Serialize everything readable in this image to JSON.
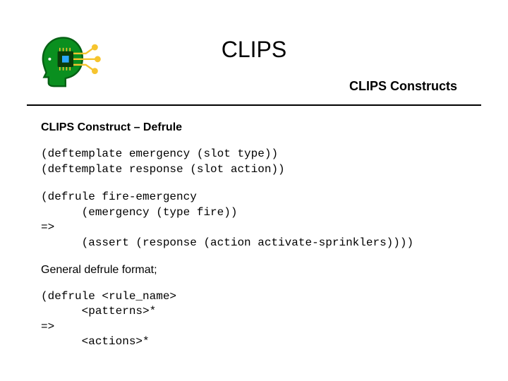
{
  "header": {
    "title": "CLIPS",
    "subtitle": "CLIPS Constructs"
  },
  "body": {
    "section_heading": "CLIPS Construct – Defrule",
    "code1": "(deftemplate emergency (slot type))\n(deftemplate response (slot action))",
    "code2": "(defrule fire-emergency\n      (emergency (type fire))\n=>\n      (assert (response (action activate-sprinklers))))",
    "general_heading": "General defrule format;",
    "code3": "(defrule <rule_name>\n      <patterns>*\n=>\n      <actions>*"
  },
  "logo": {
    "name": "clips-logo-icon",
    "colors": {
      "head": "#0a8f1f",
      "head_outline": "#066014",
      "chip_body": "#0a3d0a",
      "chip_core": "#2aa8ff",
      "trace": "#f6c42e"
    }
  }
}
